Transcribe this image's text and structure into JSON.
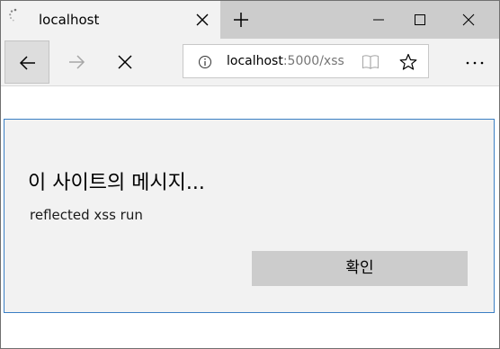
{
  "tab": {
    "title": "localhost",
    "loading": true
  },
  "window_controls": {
    "minimize_icon": "minimize-icon",
    "maximize_icon": "maximize-icon",
    "close_icon": "close-icon"
  },
  "navigation": {
    "back_icon": "arrow-left-icon",
    "forward_icon": "arrow-right-icon",
    "stop_icon": "stop-x-icon",
    "more_icon": "more-dots-icon"
  },
  "address_bar": {
    "host": "localhost",
    "path": ":5000/xss",
    "info_icon": "info-icon",
    "reading_view_icon": "book-icon",
    "favorite_icon": "star-icon"
  },
  "dialog": {
    "title": "이 사이트의 메시지...",
    "message": "reflected xss run",
    "ok_label": "확인"
  },
  "colors": {
    "titlebar": "#cccccc",
    "active_tab": "#f2f2f2",
    "dialog_bg": "#f2f2f2",
    "dialog_border": "#3a7fc4",
    "ok_button": "#cccccc"
  }
}
